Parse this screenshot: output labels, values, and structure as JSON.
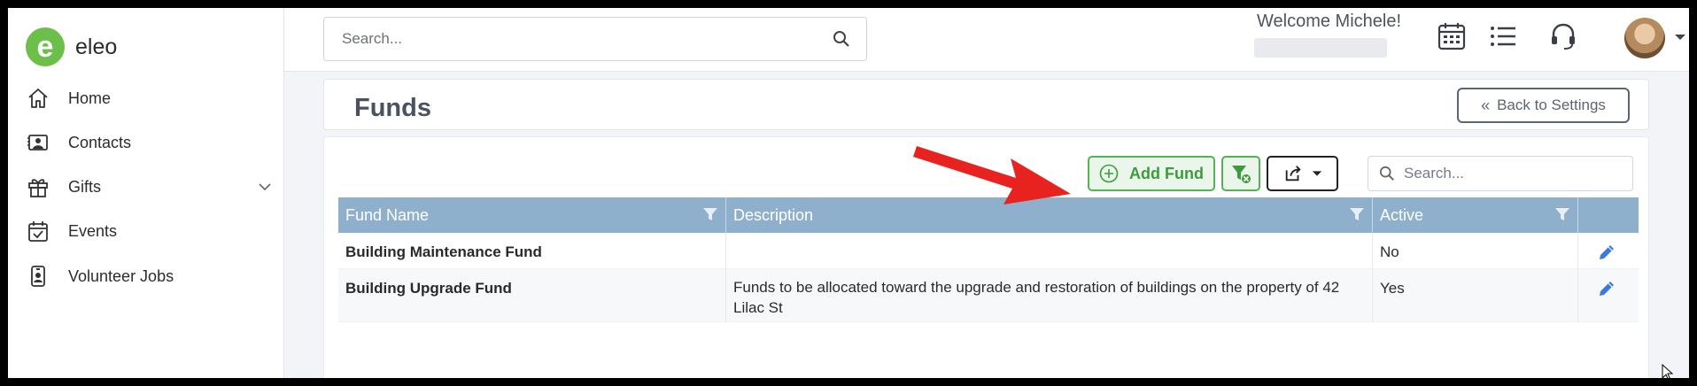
{
  "brand": {
    "name": "eleo",
    "logo_letter": "e",
    "accent": "#6cc04a"
  },
  "sidebar": {
    "items": [
      {
        "label": "Home",
        "icon": "home-icon"
      },
      {
        "label": "Contacts",
        "icon": "contact-card-icon"
      },
      {
        "label": "Gifts",
        "icon": "gift-icon",
        "expandable": true
      },
      {
        "label": "Events",
        "icon": "calendar-check-icon"
      },
      {
        "label": "Volunteer Jobs",
        "icon": "badge-icon"
      }
    ]
  },
  "header": {
    "search_placeholder": "Search...",
    "welcome": "Welcome Michele!",
    "icons": [
      "calendar-icon",
      "list-icon",
      "headset-icon"
    ]
  },
  "page": {
    "title": "Funds",
    "back_label": "Back to Settings"
  },
  "toolbar": {
    "add_label": "Add Fund",
    "search_placeholder": "Search..."
  },
  "table": {
    "columns": [
      "Fund Name",
      "Description",
      "Active",
      ""
    ],
    "rows": [
      {
        "name": "Building Maintenance Fund",
        "description": "",
        "active": "No"
      },
      {
        "name": "Building Upgrade Fund",
        "description": "Funds to be allocated toward the upgrade and restoration of buildings on the property of 42 Lilac St",
        "active": "Yes"
      }
    ]
  },
  "colors": {
    "table_header": "#8fb0cc",
    "add_button": "#55b155",
    "annotation_arrow": "#e8231f",
    "edit_icon": "#3b7ad9"
  }
}
